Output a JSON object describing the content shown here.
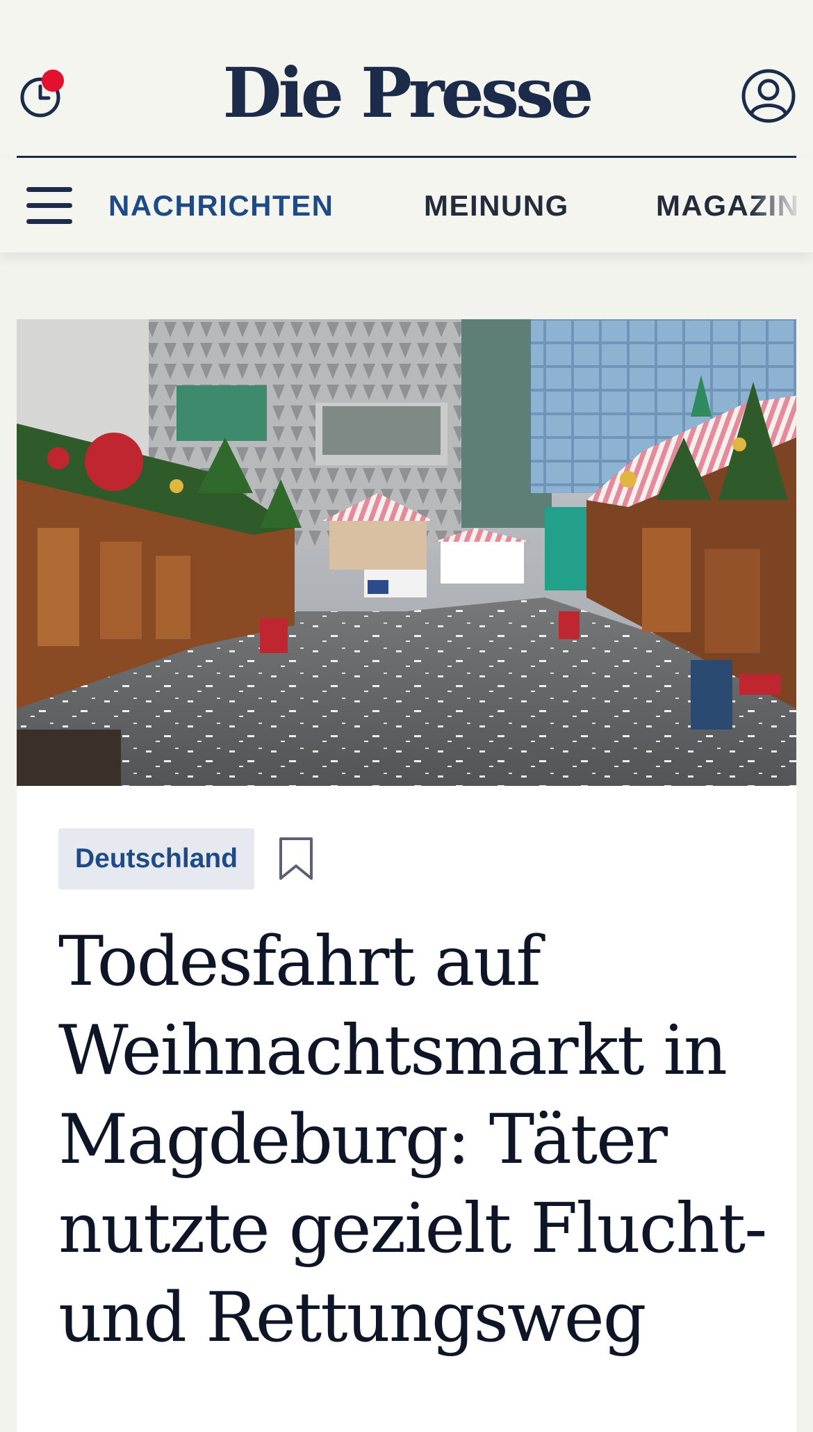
{
  "header": {
    "logo": "Die Presse",
    "history_icon": "clock-history-icon",
    "notification_color": "#e3112d",
    "profile_icon": "user-profile-icon"
  },
  "nav": {
    "menu_icon": "hamburger-menu-icon",
    "items": [
      {
        "label": "NACHRICHTEN",
        "active": true
      },
      {
        "label": "MEINUNG",
        "active": false
      },
      {
        "label": "MAGAZIN",
        "active": false
      }
    ]
  },
  "article": {
    "category": "Deutschland",
    "bookmark_icon": "bookmark-icon",
    "headline": "Todesfahrt auf Weihnachtsmarkt in Magdeburg: Täter nutzte gezielt Flucht- und Rettungsweg"
  },
  "colors": {
    "brand_navy": "#1c2b4a",
    "nav_active": "#1e4b86",
    "tag_bg": "#e6eaf0"
  }
}
